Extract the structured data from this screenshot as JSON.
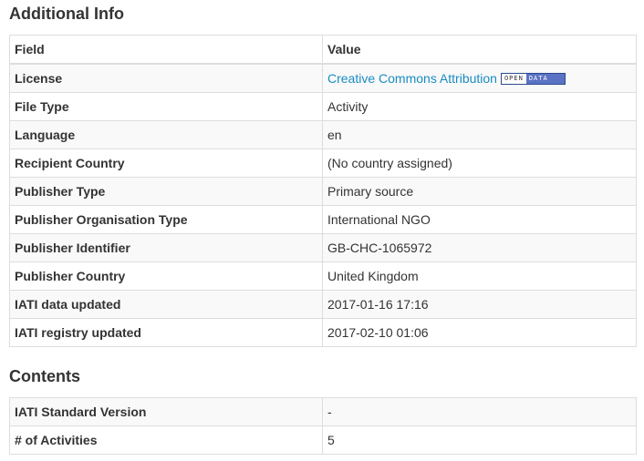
{
  "additional": {
    "heading": "Additional Info",
    "columns": {
      "field": "Field",
      "value": "Value"
    },
    "rows": [
      {
        "field": "License",
        "value": "Creative Commons Attribution"
      },
      {
        "field": "File Type",
        "value": "Activity"
      },
      {
        "field": "Language",
        "value": "en"
      },
      {
        "field": "Recipient Country",
        "value": "(No country assigned)"
      },
      {
        "field": "Publisher Type",
        "value": "Primary source"
      },
      {
        "field": "Publisher Organisation Type",
        "value": "International NGO"
      },
      {
        "field": "Publisher Identifier",
        "value": "GB-CHC-1065972"
      },
      {
        "field": "Publisher Country",
        "value": "United Kingdom"
      },
      {
        "field": "IATI data updated",
        "value": "2017-01-16 17:16"
      },
      {
        "field": "IATI registry updated",
        "value": "2017-02-10 01:06"
      }
    ],
    "badge": {
      "left": "OPEN",
      "right": "DATA"
    }
  },
  "contents": {
    "heading": "Contents",
    "rows": [
      {
        "field": "IATI Standard Version",
        "value": "-"
      },
      {
        "field": "# of Activities",
        "value": "5"
      }
    ]
  },
  "colors": {
    "link": "#1a8cc2",
    "border": "#dddddd",
    "stripe": "#f9f9f9",
    "badge_blue": "#5b72c4"
  }
}
